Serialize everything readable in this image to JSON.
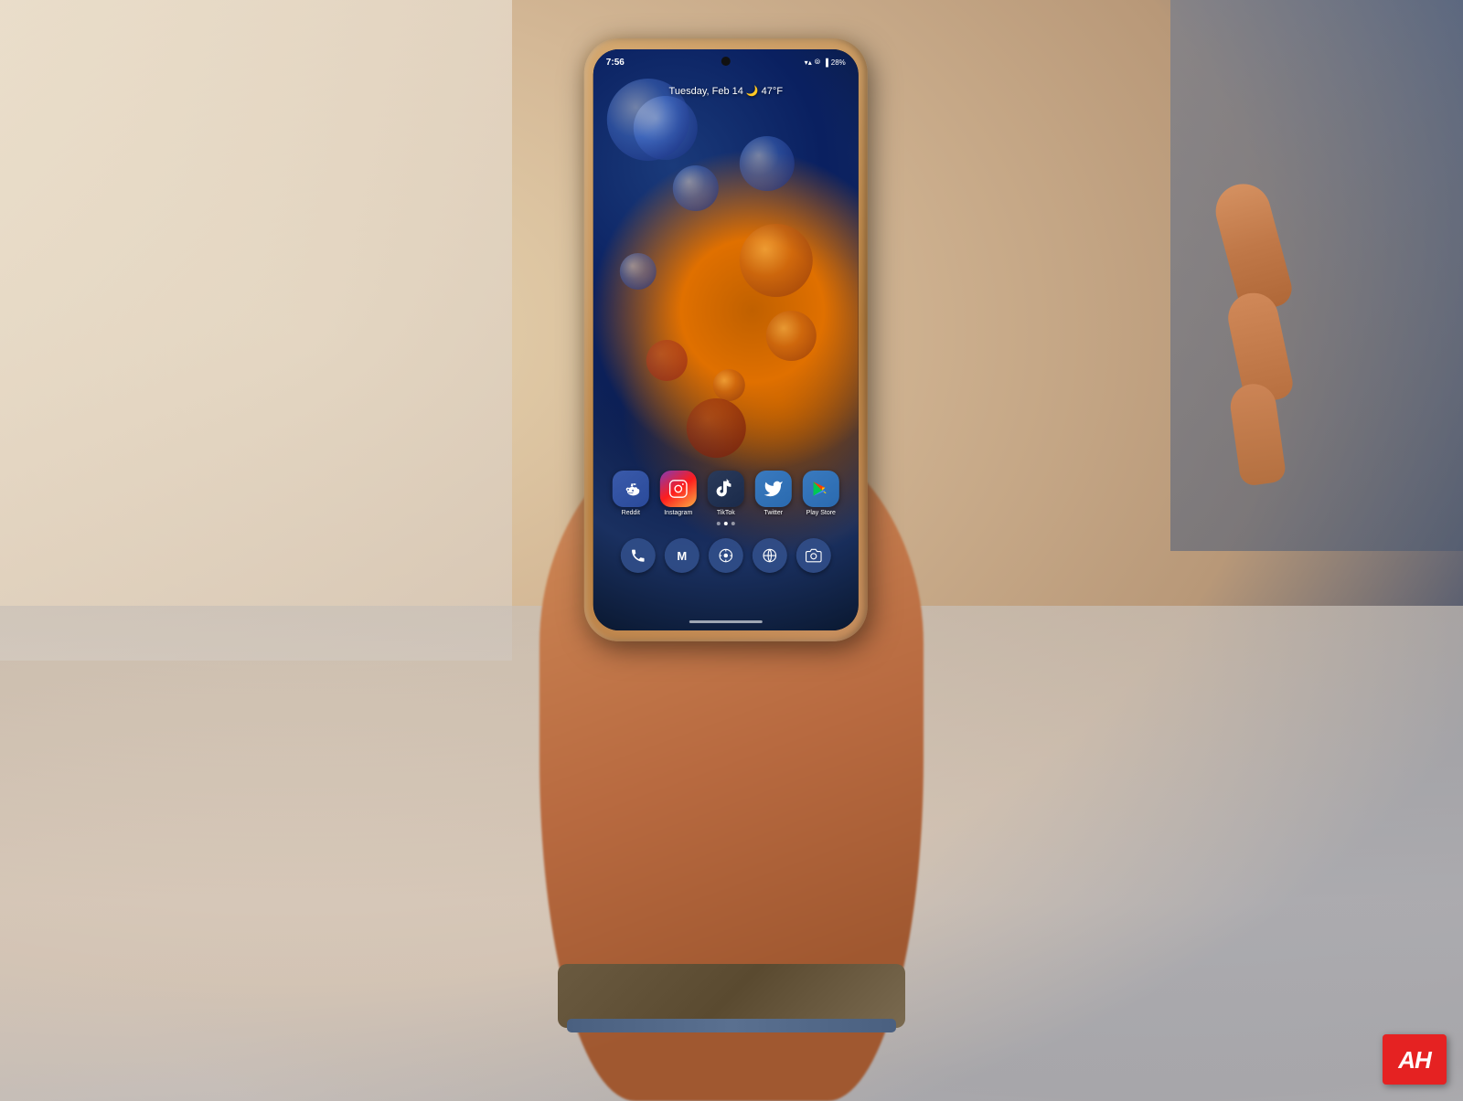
{
  "photo": {
    "description": "Hand holding Samsung Galaxy phone showing home screen"
  },
  "phone": {
    "status_bar": {
      "time": "7:56",
      "battery": "28%",
      "signal": "▾▴"
    },
    "date_widget": {
      "text": "Tuesday, Feb 14 🌙 47°F"
    },
    "apps": [
      {
        "id": "reddit",
        "label": "Reddit",
        "icon_type": "reddit"
      },
      {
        "id": "instagram",
        "label": "Instagram",
        "icon_type": "instagram"
      },
      {
        "id": "tiktok",
        "label": "TikTok",
        "icon_type": "tiktok"
      },
      {
        "id": "twitter",
        "label": "Twitter",
        "icon_type": "twitter"
      },
      {
        "id": "playstore",
        "label": "Play Store",
        "icon_type": "playstore"
      }
    ],
    "dock": [
      {
        "id": "phone",
        "icon": "📞"
      },
      {
        "id": "gmail",
        "icon": "M"
      },
      {
        "id": "media",
        "icon": "▶"
      },
      {
        "id": "browser",
        "icon": "◎"
      },
      {
        "id": "camera",
        "icon": "📷"
      }
    ]
  },
  "logo": {
    "text": "AH",
    "bg_color": "#e52222"
  }
}
